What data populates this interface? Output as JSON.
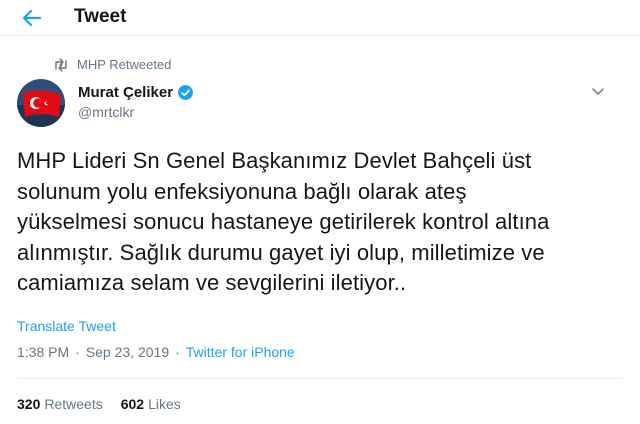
{
  "header": {
    "title": "Tweet"
  },
  "retweet": {
    "label": "MHP Retweeted"
  },
  "author": {
    "name": "Murat Çeliker",
    "handle": "@mrtclkr"
  },
  "tweet": {
    "lines": [
      "MHP Lideri Sn Genel Başkanımız Devlet Bahçeli üst",
      "solunum yolu enfeksiyonuna bağlı olarak ateş",
      "yükselmesi sonucu hastaneye getirilerek kontrol altına",
      "alınmıştır. Sağlık durumu gayet iyi olup, milletimize ve",
      "camiamıza selam ve sevgilerini iletiyor.."
    ],
    "translate_label": "Translate Tweet",
    "time": "1:38 PM",
    "separator": "·",
    "date": "Sep 23, 2019",
    "source": "Twitter for iPhone"
  },
  "stats": {
    "retweets_count": "320",
    "retweets_label": "Retweets",
    "likes_count": "602",
    "likes_label": "Likes"
  },
  "colors": {
    "accent": "#1da1f2",
    "secondary_text": "#657786",
    "primary_text": "#14171a",
    "divider": "#e6ecf0",
    "flag_red": "#e30a17"
  },
  "icons": {
    "back": "arrow-left-icon",
    "retweet": "retweet-icon",
    "verified": "verified-badge-icon",
    "more": "chevron-down-icon"
  }
}
